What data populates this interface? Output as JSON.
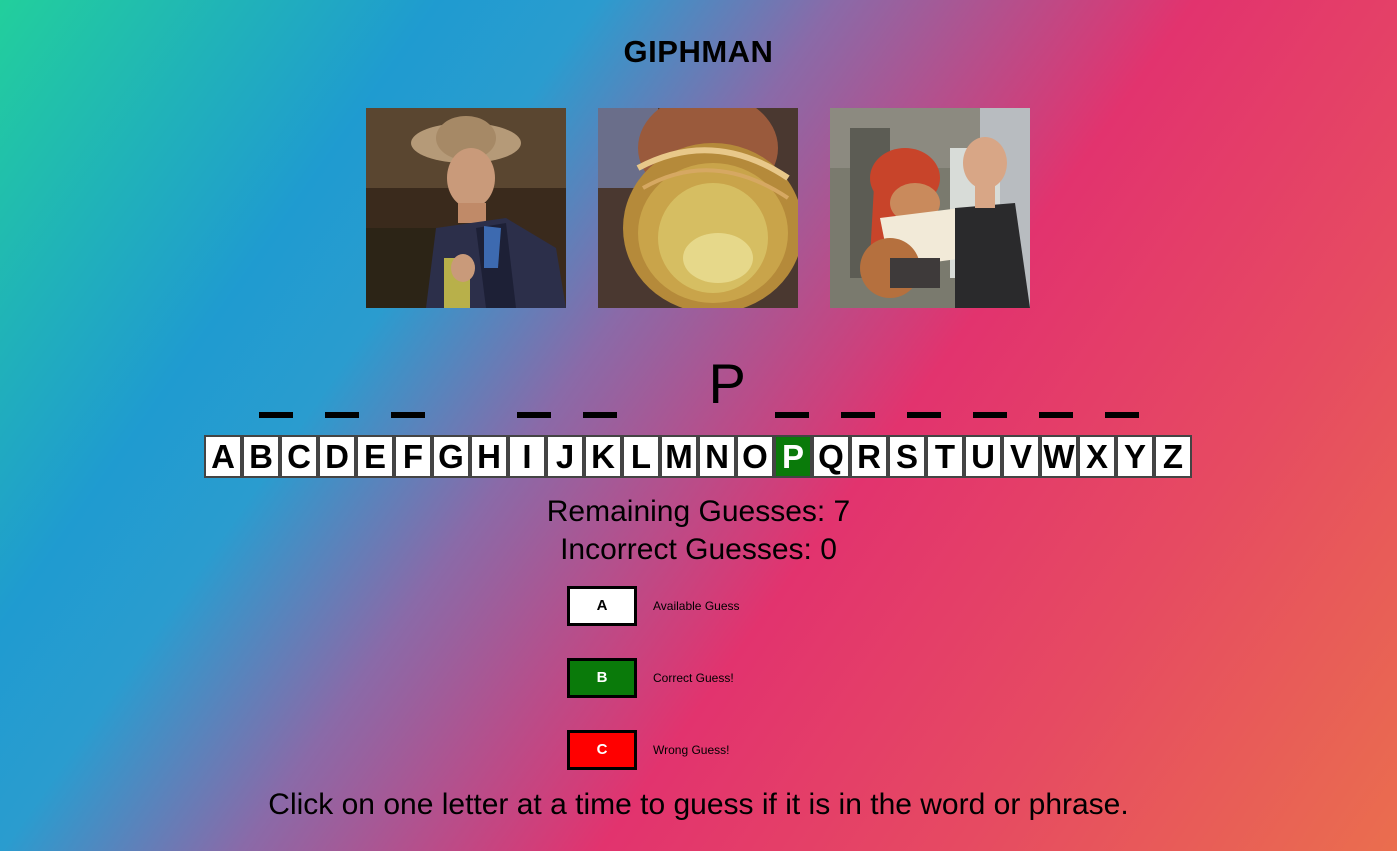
{
  "title": "GIPHMAN",
  "gifs": [
    {
      "icon": "gif-man-eating-outdoors"
    },
    {
      "icon": "gif-jar-closeup"
    },
    {
      "icon": "gif-cartoon-scene"
    }
  ],
  "word": [
    "_",
    "_",
    "_",
    " ",
    "_",
    "_",
    " ",
    "P",
    "_",
    "_",
    "_",
    "_",
    "_",
    "_"
  ],
  "alphabet": [
    "A",
    "B",
    "C",
    "D",
    "E",
    "F",
    "G",
    "H",
    "I",
    "J",
    "K",
    "L",
    "M",
    "N",
    "O",
    "P",
    "Q",
    "R",
    "S",
    "T",
    "U",
    "V",
    "W",
    "X",
    "Y",
    "Z"
  ],
  "correct_letters": [
    "P"
  ],
  "stats": {
    "remaining": "Remaining Guesses: 7",
    "incorrect": "Incorrect Guesses: 0"
  },
  "legend": {
    "available": {
      "letter": "A",
      "label": "Available Guess",
      "color": "#ffffff",
      "text": "#000000"
    },
    "correct": {
      "letter": "B",
      "label": "Correct Guess!",
      "color": "#0a7a0a",
      "text": "#ffffff"
    },
    "wrong": {
      "letter": "C",
      "label": "Wrong Guess!",
      "color": "#ff0000",
      "text": "#ffffff"
    }
  },
  "instructions": "Click on one letter at a time to guess if it is in the word or phrase."
}
